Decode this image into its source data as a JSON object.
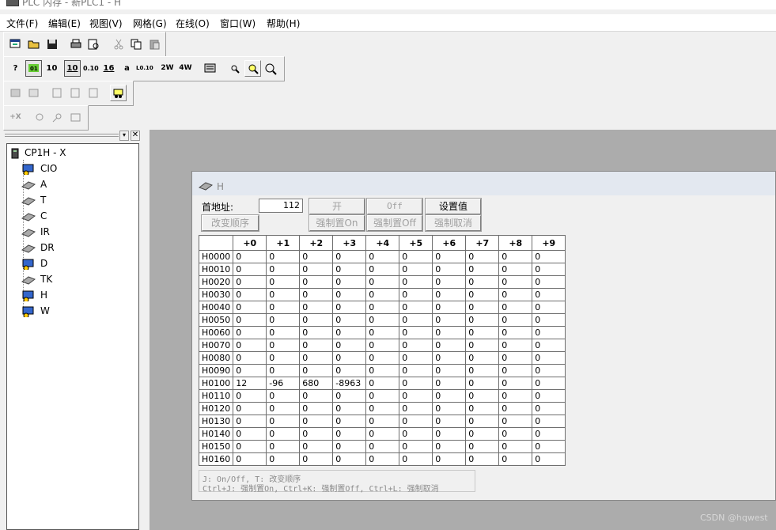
{
  "app": {
    "title": "PLC 内存 - 新PLC1 - H"
  },
  "menu": [
    "文件(F)",
    "编辑(E)",
    "视图(V)",
    "网格(G)",
    "在线(O)",
    "窗口(W)",
    "帮助(H)"
  ],
  "toolbar2": {
    "b1": "?",
    "b3": "10",
    "b4": "10",
    "b5": "0.10",
    "b6": "16",
    "b7": "a",
    "b8": "L0.10",
    "b9": "2W",
    "b10": "4W"
  },
  "toolbar4": {
    "b1": "+X"
  },
  "tree": {
    "root": "CP1H - X",
    "items": [
      "CIO",
      "A",
      "T",
      "C",
      "IR",
      "DR",
      "D",
      "TK",
      "H",
      "W"
    ]
  },
  "child": {
    "title": "H",
    "start_addr_label": "首地址:",
    "start_addr_value": "112",
    "btn_on": "开",
    "btn_off": "Off",
    "btn_set_value": "设置值",
    "btn_change_order": "改变顺序",
    "btn_force_on": "强制置On",
    "btn_force_off": "强制置Off",
    "btn_force_cancel": "强制取消",
    "columns": [
      "+0",
      "+1",
      "+2",
      "+3",
      "+4",
      "+5",
      "+6",
      "+7",
      "+8",
      "+9"
    ],
    "rows": [
      {
        "addr": "H0000",
        "v": [
          "0",
          "0",
          "0",
          "0",
          "0",
          "0",
          "0",
          "0",
          "0",
          "0"
        ]
      },
      {
        "addr": "H0010",
        "v": [
          "0",
          "0",
          "0",
          "0",
          "0",
          "0",
          "0",
          "0",
          "0",
          "0"
        ]
      },
      {
        "addr": "H0020",
        "v": [
          "0",
          "0",
          "0",
          "0",
          "0",
          "0",
          "0",
          "0",
          "0",
          "0"
        ]
      },
      {
        "addr": "H0030",
        "v": [
          "0",
          "0",
          "0",
          "0",
          "0",
          "0",
          "0",
          "0",
          "0",
          "0"
        ]
      },
      {
        "addr": "H0040",
        "v": [
          "0",
          "0",
          "0",
          "0",
          "0",
          "0",
          "0",
          "0",
          "0",
          "0"
        ]
      },
      {
        "addr": "H0050",
        "v": [
          "0",
          "0",
          "0",
          "0",
          "0",
          "0",
          "0",
          "0",
          "0",
          "0"
        ]
      },
      {
        "addr": "H0060",
        "v": [
          "0",
          "0",
          "0",
          "0",
          "0",
          "0",
          "0",
          "0",
          "0",
          "0"
        ]
      },
      {
        "addr": "H0070",
        "v": [
          "0",
          "0",
          "0",
          "0",
          "0",
          "0",
          "0",
          "0",
          "0",
          "0"
        ]
      },
      {
        "addr": "H0080",
        "v": [
          "0",
          "0",
          "0",
          "0",
          "0",
          "0",
          "0",
          "0",
          "0",
          "0"
        ]
      },
      {
        "addr": "H0090",
        "v": [
          "0",
          "0",
          "0",
          "0",
          "0",
          "0",
          "0",
          "0",
          "0",
          "0"
        ]
      },
      {
        "addr": "H0100",
        "v": [
          "12",
          "-96",
          "680",
          "-8963",
          "0",
          "0",
          "0",
          "0",
          "0",
          "0"
        ]
      },
      {
        "addr": "H0110",
        "v": [
          "0",
          "0",
          "0",
          "0",
          "0",
          "0",
          "0",
          "0",
          "0",
          "0"
        ]
      },
      {
        "addr": "H0120",
        "v": [
          "0",
          "0",
          "0",
          "0",
          "0",
          "0",
          "0",
          "0",
          "0",
          "0"
        ]
      },
      {
        "addr": "H0130",
        "v": [
          "0",
          "0",
          "0",
          "0",
          "0",
          "0",
          "0",
          "0",
          "0",
          "0"
        ]
      },
      {
        "addr": "H0140",
        "v": [
          "0",
          "0",
          "0",
          "0",
          "0",
          "0",
          "0",
          "0",
          "0",
          "0"
        ]
      },
      {
        "addr": "H0150",
        "v": [
          "0",
          "0",
          "0",
          "0",
          "0",
          "0",
          "0",
          "0",
          "0",
          "0"
        ]
      },
      {
        "addr": "H0160",
        "v": [
          "0",
          "0",
          "0",
          "0",
          "0",
          "0",
          "0",
          "0",
          "0",
          "0"
        ]
      }
    ],
    "help_line1": "J: On/Off,   T: 改变顺序",
    "help_line2": "Ctrl+J: 强制置On,  Ctrl+K:  强制置Off,  Ctrl+L: 强制取消"
  },
  "watermark": "CSDN @hqwest"
}
